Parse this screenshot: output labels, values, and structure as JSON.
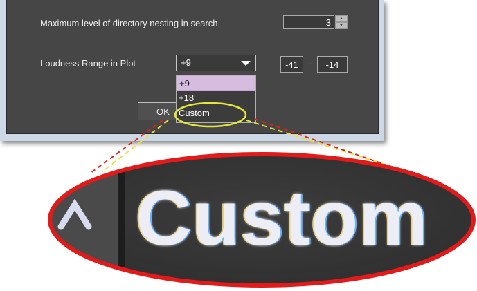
{
  "settings": {
    "nesting_label": "Maximum level of directory nesting in search",
    "nesting_value": "3",
    "loudness_label": "Loudness Range in Plot",
    "loudness_selected": "+9",
    "range_min": "-41",
    "range_sep": "-",
    "range_max": "-14",
    "ok_label": "OK"
  },
  "dropdown": {
    "options": [
      "+9",
      "+18",
      "Custom"
    ]
  },
  "zoom": {
    "text": "Custom"
  },
  "colors": {
    "panel": "#464646",
    "highlight": "#d6bde0",
    "callout_small": "#e5e83a",
    "callout_large": "#e41a1a"
  }
}
